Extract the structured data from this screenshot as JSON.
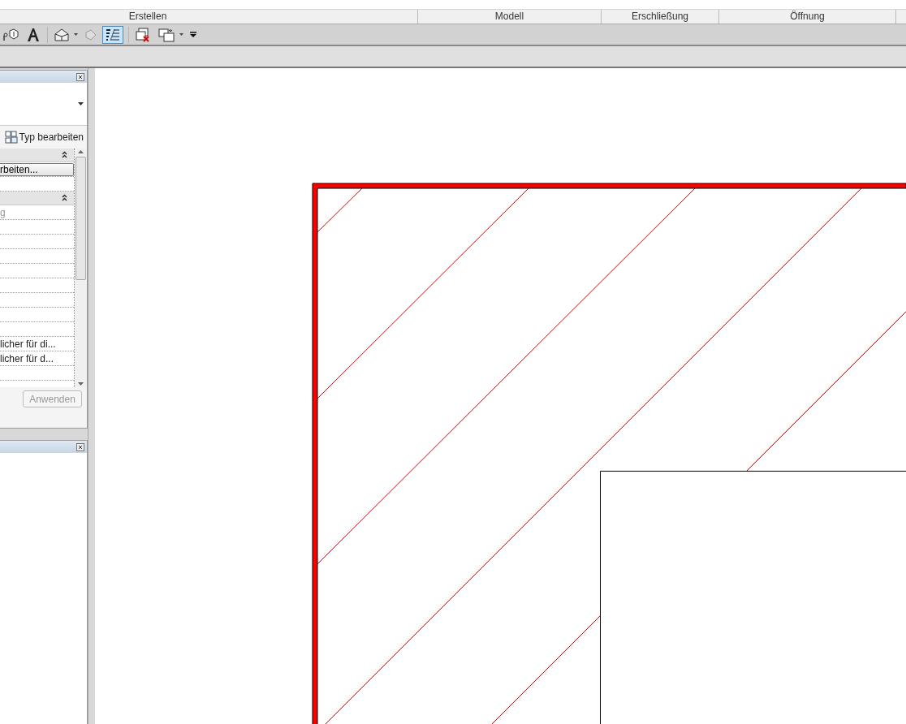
{
  "ribbon": {
    "panels": [
      {
        "label": "Erstellen"
      },
      {
        "label": "Modell"
      },
      {
        "label": "Erschließung"
      },
      {
        "label": "Öffnung"
      }
    ]
  },
  "quick_access": [
    {
      "kind": "tag",
      "dropdown": false,
      "selected": false
    },
    {
      "kind": "text",
      "dropdown": false,
      "selected": false
    },
    {
      "kind": "house",
      "dropdown": true,
      "selected": false
    },
    {
      "kind": "point",
      "dropdown": false,
      "selected": false
    },
    {
      "kind": "thinlines",
      "dropdown": false,
      "selected": true
    },
    {
      "kind": "closewin",
      "dropdown": false,
      "selected": false
    },
    {
      "kind": "switchwin",
      "dropdown": true,
      "selected": false
    },
    {
      "kind": "customize",
      "dropdown": false,
      "selected": false
    }
  ],
  "properties": {
    "edit_type": "Typ bearbeiten",
    "groups": [
      {
        "expanded": true,
        "rows": [
          {
            "kind": "button",
            "value": "rbeiten..."
          },
          {
            "kind": "plain",
            "value": ""
          }
        ]
      },
      {
        "expanded": true,
        "rows": [
          {
            "kind": "plain",
            "value": "g",
            "disabled": true
          },
          {
            "kind": "plain",
            "value": ""
          },
          {
            "kind": "plain",
            "value": ""
          },
          {
            "kind": "plain",
            "value": ""
          },
          {
            "kind": "plain",
            "value": ""
          },
          {
            "kind": "plain",
            "value": ""
          },
          {
            "kind": "plain",
            "value": ""
          },
          {
            "kind": "plain",
            "value": ""
          },
          {
            "kind": "plain",
            "value": ""
          },
          {
            "kind": "plain",
            "value": "licher für di..."
          },
          {
            "kind": "plain",
            "value": "licher für d..."
          },
          {
            "kind": "plain",
            "value": ""
          }
        ]
      }
    ],
    "apply_button": {
      "label": "Anwenden",
      "disabled": true
    }
  }
}
